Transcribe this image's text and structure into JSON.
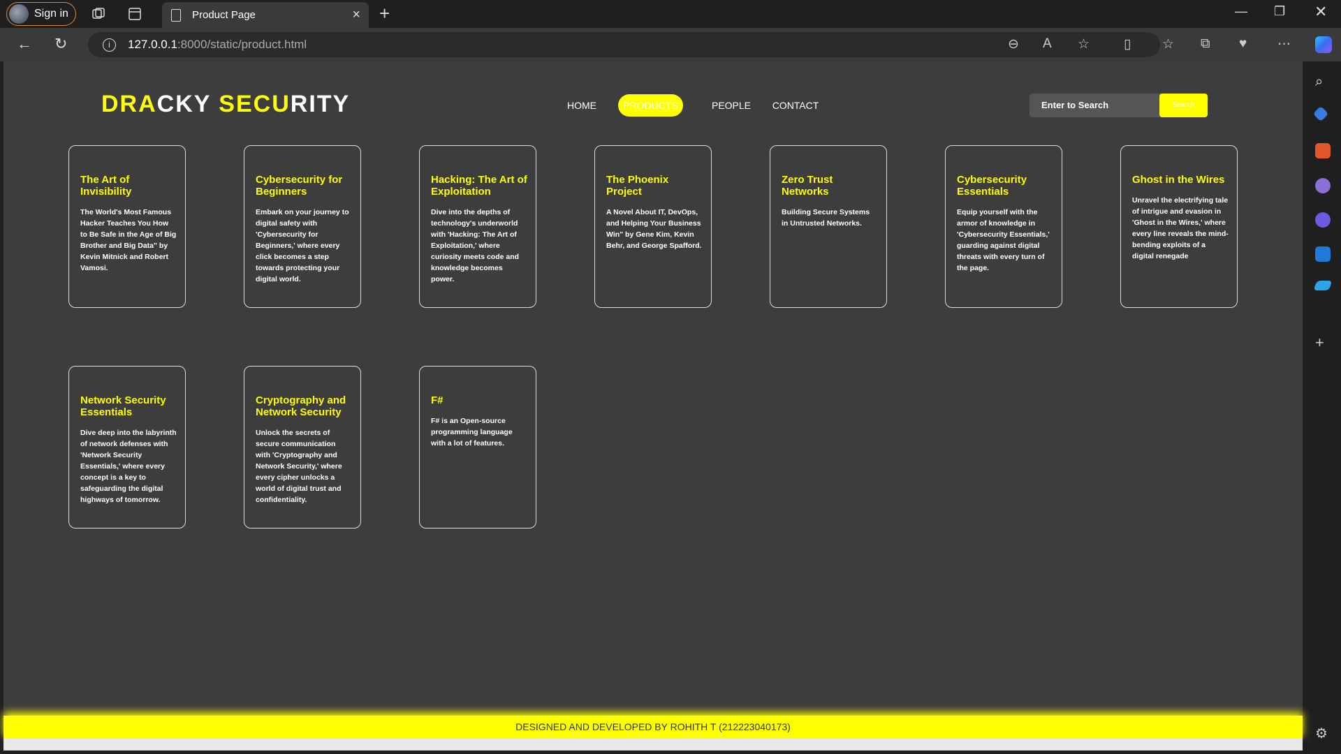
{
  "browser": {
    "signin_label": "Sign in",
    "tab_title": "Product Page",
    "url_host": "127.0.0.1",
    "url_path": ":8000/static/product.html"
  },
  "site": {
    "logo": {
      "part1": "DRA",
      "part2": "CKY ",
      "part3": "SECU",
      "part4": "RITY"
    },
    "nav": [
      "HOME",
      "PRODUCTS",
      "PEOPLE",
      "CONTACT"
    ],
    "active_nav": "PRODUCTS",
    "search_placeholder": "Enter to Search",
    "search_button": "Search",
    "accent_color": "#ffff00",
    "background_color": "#3d3d3d"
  },
  "products": [
    {
      "title": "The Art of Invisibility",
      "desc": "The World's Most Famous Hacker Teaches You How to Be Safe in the Age of Big Brother and Big Data\" by Kevin Mitnick and Robert Vamosi."
    },
    {
      "title": "Cybersecurity for Beginners",
      "desc": "Embark on your journey to digital safety with 'Cybersecurity for Beginners,' where every click becomes a step towards protecting your digital world."
    },
    {
      "title": "Hacking: The Art of Exploitation",
      "desc": "Dive into the depths of technology's underworld with 'Hacking: The Art of Exploitation,' where curiosity meets code and knowledge becomes power."
    },
    {
      "title": "The Phoenix Project",
      "desc": "A Novel About IT, DevOps, and Helping Your Business Win\" by Gene Kim, Kevin Behr, and George Spafford."
    },
    {
      "title": "Zero Trust Networks",
      "desc": "Building Secure Systems in Untrusted Networks."
    },
    {
      "title": "Cybersecurity Essentials",
      "desc": "Equip yourself with the armor of knowledge in 'Cybersecurity Essentials,' guarding against digital threats with every turn of the page."
    },
    {
      "title": "Ghost in the Wires",
      "desc": "Unravel the electrifying tale of intrigue and evasion in 'Ghost in the Wires,' where every line reveals the mind-bending exploits of a digital renegade"
    },
    {
      "title": "Network Security Essentials",
      "desc": "Dive deep into the labyrinth of network defenses with 'Network Security Essentials,' where every concept is a key to safeguarding the digital highways of tomorrow."
    },
    {
      "title": "Cryptography and Network Security",
      "desc": "Unlock the secrets of secure communication with 'Cryptography and Network Security,' where every cipher unlocks a world of digital trust and confidentiality."
    },
    {
      "title": "F#",
      "desc": "F# is an Open-source programming language with a lot of features."
    }
  ],
  "footer": "DESIGNED AND DEVELOPED BY ROHITH T (212223040173)"
}
